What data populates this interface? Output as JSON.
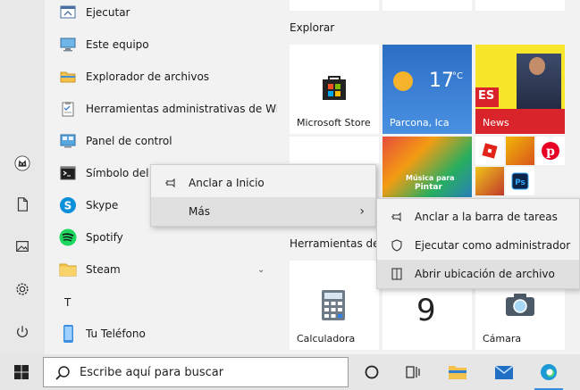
{
  "taskbar": {
    "search_placeholder": "Escribe aquí para buscar"
  },
  "apps": {
    "items": [
      {
        "label": "Ejecutar",
        "icon": "run-icon"
      },
      {
        "label": "Este equipo",
        "icon": "computer-icon"
      },
      {
        "label": "Explorador de archivos",
        "icon": "folder-icon"
      },
      {
        "label": "Herramientas administrativas de Wi...",
        "icon": "admin-tools-icon"
      },
      {
        "label": "Panel de control",
        "icon": "control-panel-icon"
      },
      {
        "label": "Símbolo del",
        "icon": "command-prompt-icon"
      },
      {
        "label": "Skype",
        "icon": "skype-icon"
      },
      {
        "label": "Spotify",
        "icon": "spotify-icon"
      },
      {
        "label": "Steam",
        "icon": "folder-icon"
      },
      {
        "label": "Tu Teléfono",
        "icon": "phone-icon"
      }
    ],
    "letter_t": "T"
  },
  "tiles": {
    "group_explorar": "Explorar",
    "group_herramientas": "Herramientas de W",
    "microsoft_store": "Microsoft Store",
    "weather_temp": "17",
    "weather_unit": "°C",
    "weather_place": "Parcona, Ica",
    "news_label": "News",
    "news_tag": "ES",
    "music_label_1": "Música para",
    "music_label_2": "Pintar",
    "calculadora": "Calculadora",
    "clock_number": "9",
    "camara": "Cámara"
  },
  "context_menu": {
    "pin_start": "Anclar a Inicio",
    "more": "Más"
  },
  "submenu": {
    "pin_taskbar": "Anclar a la barra de tareas",
    "run_admin": "Ejecutar como administrador",
    "open_location": "Abrir ubicación de archivo"
  }
}
